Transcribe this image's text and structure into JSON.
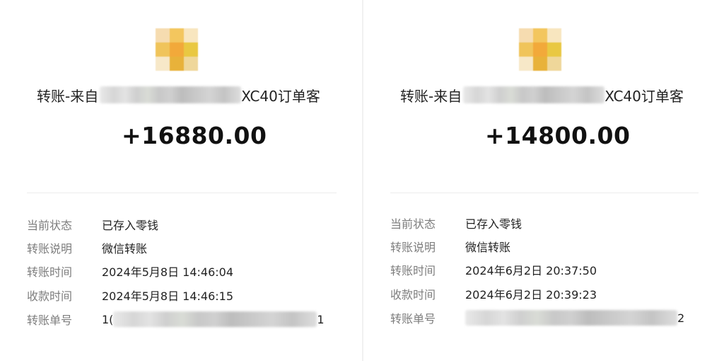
{
  "receipts": [
    {
      "title_prefix": "转账-来自",
      "title_suffix": "XC40订单客",
      "amount": "+16880.00",
      "status_label": "当前状态",
      "status_value": "已存入零钱",
      "desc_label": "转账说明",
      "desc_value": "微信转账",
      "transfer_time_label": "转账时间",
      "transfer_time_value": "2024年5月8日 14:46:04",
      "receive_time_label": "收款时间",
      "receive_time_value": "2024年5月8日 14:46:15",
      "order_no_label": "转账单号",
      "order_no_start": "1(",
      "order_no_end": "1"
    },
    {
      "title_prefix": "转账-来自",
      "title_suffix": "XC40订单客",
      "amount": "+14800.00",
      "status_label": "当前状态",
      "status_value": "已存入零钱",
      "desc_label": "转账说明",
      "desc_value": "微信转账",
      "transfer_time_label": "转账时间",
      "transfer_time_value": "2024年6月2日 20:37:50",
      "receive_time_label": "收款时间",
      "receive_time_value": "2024年6月2日 20:39:23",
      "order_no_label": "转账单号",
      "order_no_start": "",
      "order_no_end": "2"
    }
  ],
  "colors": {
    "avatar_palette": [
      "#f6dcb0",
      "#f3c65e",
      "#f8e6bf",
      "#f0c45a",
      "#f2a93a",
      "#e9c842",
      "#f7e8c8",
      "#e8b23a",
      "#efd79a"
    ]
  }
}
